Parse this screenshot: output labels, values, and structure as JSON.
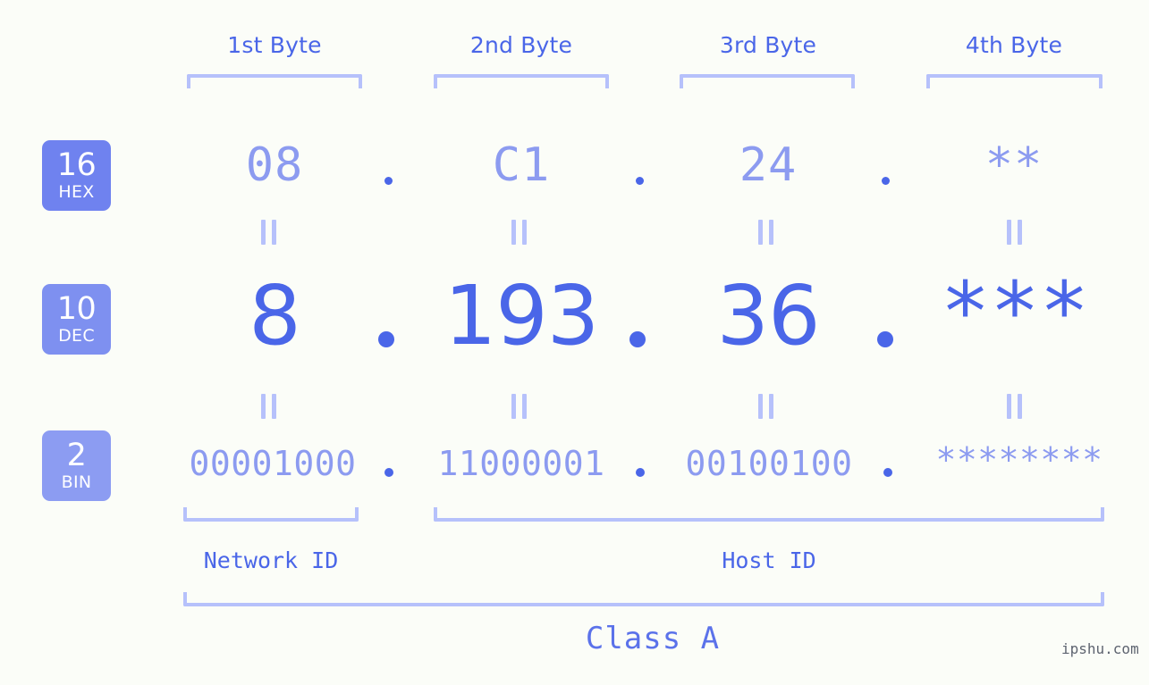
{
  "page": {
    "background_color": "#fbfdf8",
    "accent_color": "#4a66e8",
    "muted_color": "#8c9bf0",
    "bracket_color": "#b6c1fb",
    "badge_strong_color": "#6f82ef",
    "badge_light_color": "#8c9bf0",
    "watermark": "ipshu.com"
  },
  "byte_headers": [
    {
      "label": "1st Byte"
    },
    {
      "label": "2nd Byte"
    },
    {
      "label": "3rd Byte"
    },
    {
      "label": "4th Byte"
    }
  ],
  "rows": [
    {
      "badge": {
        "number": "16",
        "name": "HEX"
      },
      "values": [
        "08",
        "C1",
        "24",
        "**"
      ],
      "separator": "."
    },
    {
      "badge": {
        "number": "10",
        "name": "DEC"
      },
      "values": [
        "8",
        "193",
        "36",
        "***"
      ],
      "separator": "."
    },
    {
      "badge": {
        "number": "2",
        "name": "BIN"
      },
      "values": [
        "00001000",
        "11000001",
        "00100100",
        "********"
      ],
      "separator": "."
    }
  ],
  "equality_marker": "||",
  "id_labels": [
    {
      "label": "Network ID"
    },
    {
      "label": "Host ID"
    }
  ],
  "class_label": "Class A"
}
